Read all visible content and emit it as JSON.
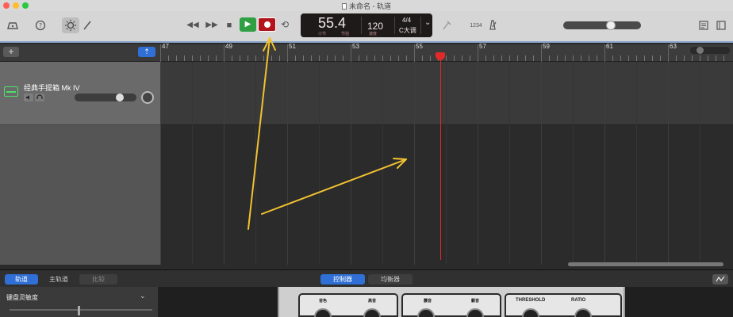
{
  "window": {
    "title": "未命名 - 轨道"
  },
  "toolbar": {
    "icons": [
      "library-icon",
      "help-icon",
      "smart-controls-icon",
      "editors-icon"
    ],
    "transport": {
      "rewind": "◀◀",
      "forward": "▶▶",
      "stop": "■",
      "play": "▶",
      "cycle": "⟲"
    },
    "lcd": {
      "position": "55.4",
      "sub_bar": "小节",
      "sub_beat": "节拍",
      "tempo": "120",
      "tempo_label": "速度",
      "signature": "4/4",
      "key": "C大调",
      "chevron": "⌄"
    },
    "count_in": "1234",
    "metronome_icon": "metronome-icon"
  },
  "tracks_header": {
    "add_label": "+",
    "filter_label": "⇡"
  },
  "track": {
    "name": "经典手提箱 Mk IV",
    "mute_icon": "🔇",
    "headphones_icon": "🎧"
  },
  "ruler": {
    "bars": [
      "47",
      "49",
      "51",
      "53",
      "55",
      "57",
      "59",
      "61",
      "63"
    ]
  },
  "bottom_tabs": {
    "left": [
      "轨道",
      "主轨道",
      "比较"
    ],
    "center": [
      "控制器",
      "均衡器"
    ]
  },
  "inspector": {
    "label": "键盘灵敏度",
    "chevron": "⌄"
  },
  "smart_controls": {
    "module1": [
      "音色",
      "高音"
    ],
    "module2": [
      "震音",
      "颤音"
    ],
    "module3": [
      "THRESHOLD",
      "RATIO"
    ]
  },
  "colors": {
    "accent": "#2f6fd6",
    "play": "#2ea043",
    "record": "#b3141c",
    "playhead": "#e02a2a",
    "annotation_arrow": "#f2c230"
  }
}
